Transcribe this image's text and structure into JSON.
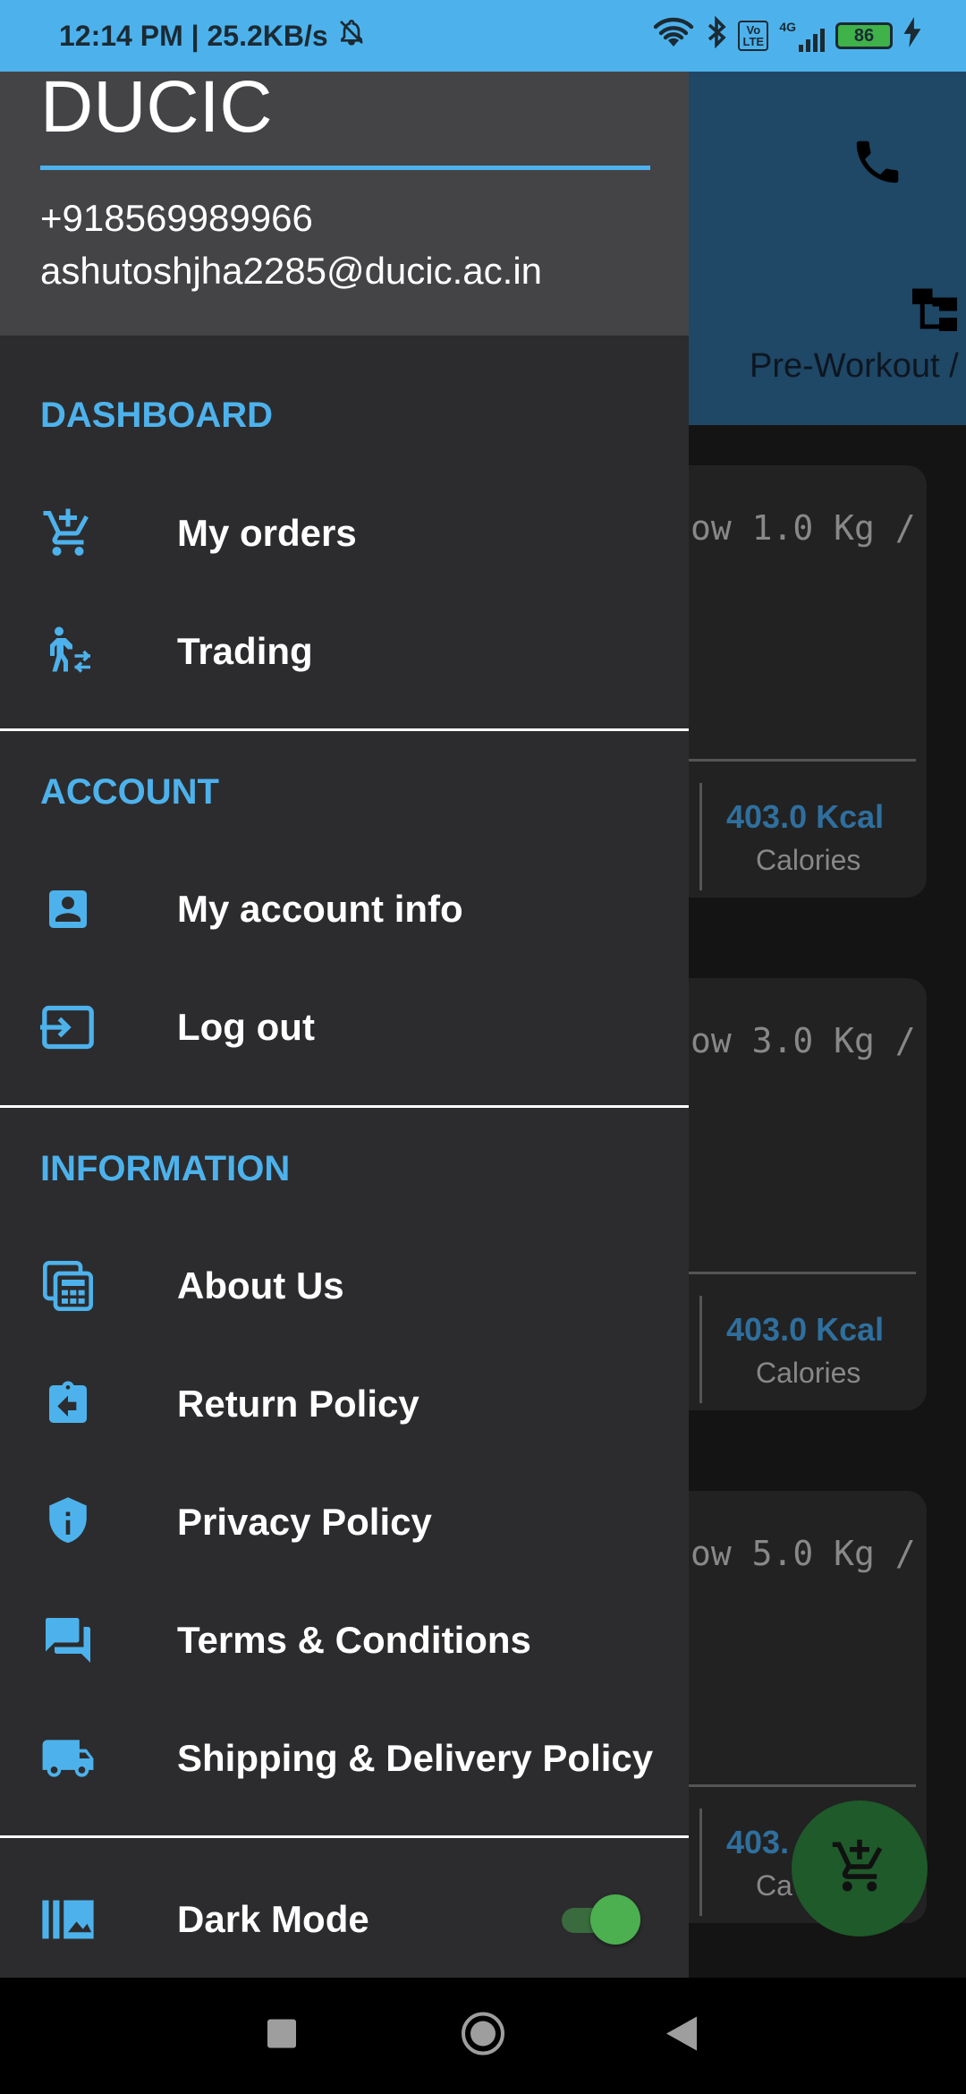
{
  "status_bar": {
    "time_speed": "12:14 PM | 25.2KB/s",
    "network": "4G",
    "volte": "Vo LTE",
    "battery": "86"
  },
  "background": {
    "category_label": "Pre-Workout /",
    "cards": [
      {
        "weight": "ow 1.0 Kg /",
        "kcal": "403.0 Kcal",
        "kcal_label": "Calories"
      },
      {
        "weight": "ow 3.0 Kg /",
        "kcal": "403.0 Kcal",
        "kcal_label": "Calories"
      },
      {
        "weight": "ow 5.0 Kg /",
        "kcal": "403.",
        "kcal_label": "Ca"
      }
    ]
  },
  "drawer": {
    "brand": "DUCIC",
    "phone": "+918569989966",
    "email": "ashutoshjha2285@ducic.ac.in",
    "sections": {
      "dashboard": "DASHBOARD",
      "account": "ACCOUNT",
      "information": "INFORMATION"
    },
    "items": {
      "my_orders": "My orders",
      "trading": "Trading",
      "my_account_info": "My account info",
      "log_out": "Log out",
      "about_us": "About Us",
      "return_policy": "Return Policy",
      "privacy_policy": "Privacy Policy",
      "terms": "Terms & Conditions",
      "shipping": "Shipping & Delivery Policy",
      "dark_mode": "Dark Mode"
    },
    "dark_mode_on": true,
    "accent_color": "#4db2ec",
    "icons": {
      "my_orders": "add-cart-icon",
      "trading": "person-swap-icon",
      "my_account_info": "account-box-icon",
      "log_out": "logout-icon",
      "about_us": "calculator-icon",
      "return_policy": "assignment-return-icon",
      "privacy_policy": "shield-info-icon",
      "terms": "chat-bubbles-icon",
      "shipping": "truck-icon",
      "dark_mode": "photo-library-icon"
    }
  }
}
